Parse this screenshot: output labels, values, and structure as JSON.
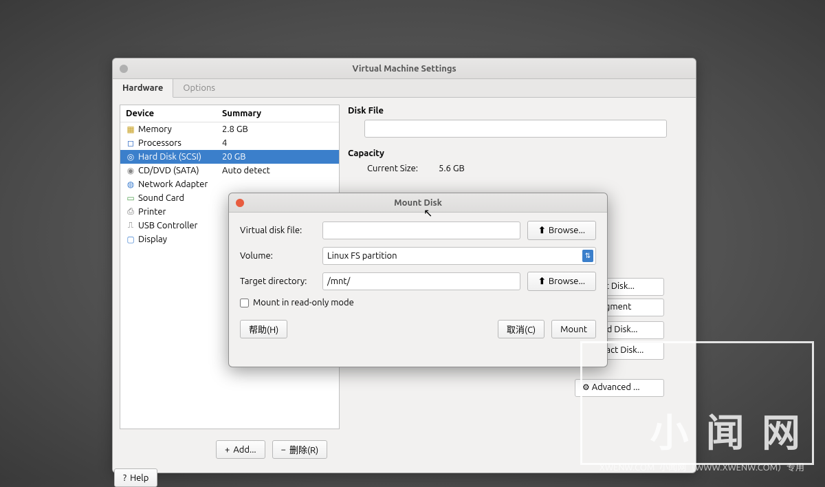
{
  "mainWindow": {
    "title": "Virtual Machine Settings",
    "tabs": {
      "hardware": "Hardware",
      "options": "Options"
    },
    "columns": {
      "device": "Device",
      "summary": "Summary"
    },
    "devices": [
      {
        "icon": "▦",
        "name": "Memory",
        "summary": "2.8 GB"
      },
      {
        "icon": "◻",
        "name": "Processors",
        "summary": "4"
      },
      {
        "icon": "◎",
        "name": "Hard Disk (SCSI)",
        "summary": "20 GB"
      },
      {
        "icon": "◉",
        "name": "CD/DVD (SATA)",
        "summary": "Auto detect"
      },
      {
        "icon": "◍",
        "name": "Network Adapter",
        "summary": ""
      },
      {
        "icon": "▭",
        "name": "Sound Card",
        "summary": ""
      },
      {
        "icon": "⎙",
        "name": "Printer",
        "summary": ""
      },
      {
        "icon": "⎍",
        "name": "USB Controller",
        "summary": ""
      },
      {
        "icon": "▢",
        "name": "Display",
        "summary": ""
      }
    ],
    "rightPanel": {
      "diskFileLabel": "Disk File",
      "capacityLabel": "Capacity",
      "currentSizeLabel": "Current Size:",
      "currentSizeValue": "5.6 GB",
      "utilities": {
        "mount": "Mount Disk...",
        "defrag": "Defragment Disk...",
        "expand": "Expand Disk...",
        "compact": "Compact Disk...",
        "advanced": "Advanced ..."
      }
    },
    "buttons": {
      "add": "Add...",
      "remove": "删除(R)",
      "help": "Help"
    }
  },
  "dialog": {
    "title": "Mount Disk",
    "labels": {
      "virtualDiskFile": "Virtual disk file:",
      "volume": "Volume:",
      "targetDirectory": "Target directory:",
      "readOnly": "Mount in read-only mode",
      "browse": "Browse..."
    },
    "values": {
      "virtualDiskFile": "",
      "volume": "Linux FS partition",
      "targetDirectory": "/mnt/"
    },
    "buttons": {
      "help": "帮助(H)",
      "cancel": "取消(C)",
      "mount": "Mount"
    }
  },
  "watermark": {
    "logo": "小 闻 网",
    "domain": "XWENW.COM",
    "note": "小闻网（WWW.XWENW.COM）专用"
  }
}
